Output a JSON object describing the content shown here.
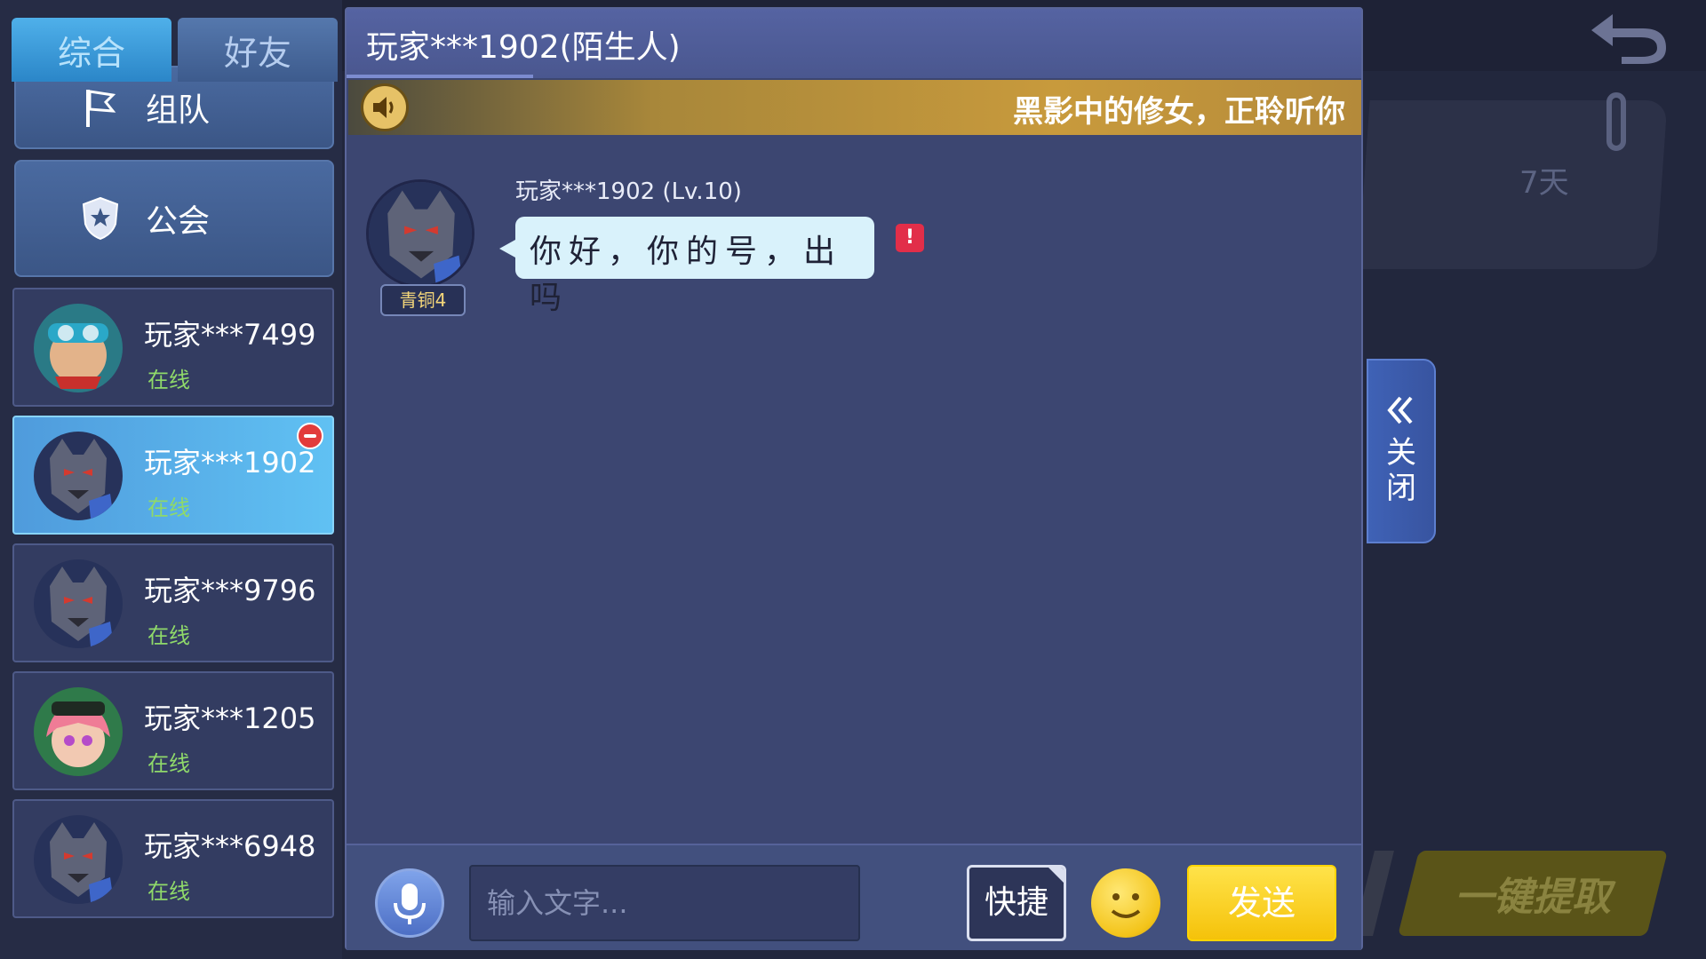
{
  "tabs": {
    "all": "综合",
    "friends": "好友"
  },
  "nav": {
    "team": "组队",
    "guild": "公会"
  },
  "friends": [
    {
      "name": "玩家***7499",
      "status": "在线"
    },
    {
      "name": "玩家***1902",
      "status": "在线"
    },
    {
      "name": "玩家***9796",
      "status": "在线"
    },
    {
      "name": "玩家***1205",
      "status": "在线"
    },
    {
      "name": "玩家***6948",
      "status": "在线"
    }
  ],
  "chat": {
    "title": "玩家***1902(陌生人)",
    "broadcast": "黑影中的修女，正聆听你",
    "message": {
      "sender": "玩家***1902  (Lv.10)",
      "rank": "青铜4",
      "text": "你好，你的号，出吗",
      "report_icon": "!"
    }
  },
  "input": {
    "placeholder": "输入文字...",
    "quick": "快捷",
    "send": "发送"
  },
  "close_tab": {
    "chevron": "《",
    "label": "关闭"
  },
  "background": {
    "days": "7天",
    "claim_all": "一键提取"
  },
  "colors": {
    "online": "#8fd96a",
    "send": "#f5c20a",
    "selected": "#60c1f3",
    "report": "#e22e49"
  }
}
